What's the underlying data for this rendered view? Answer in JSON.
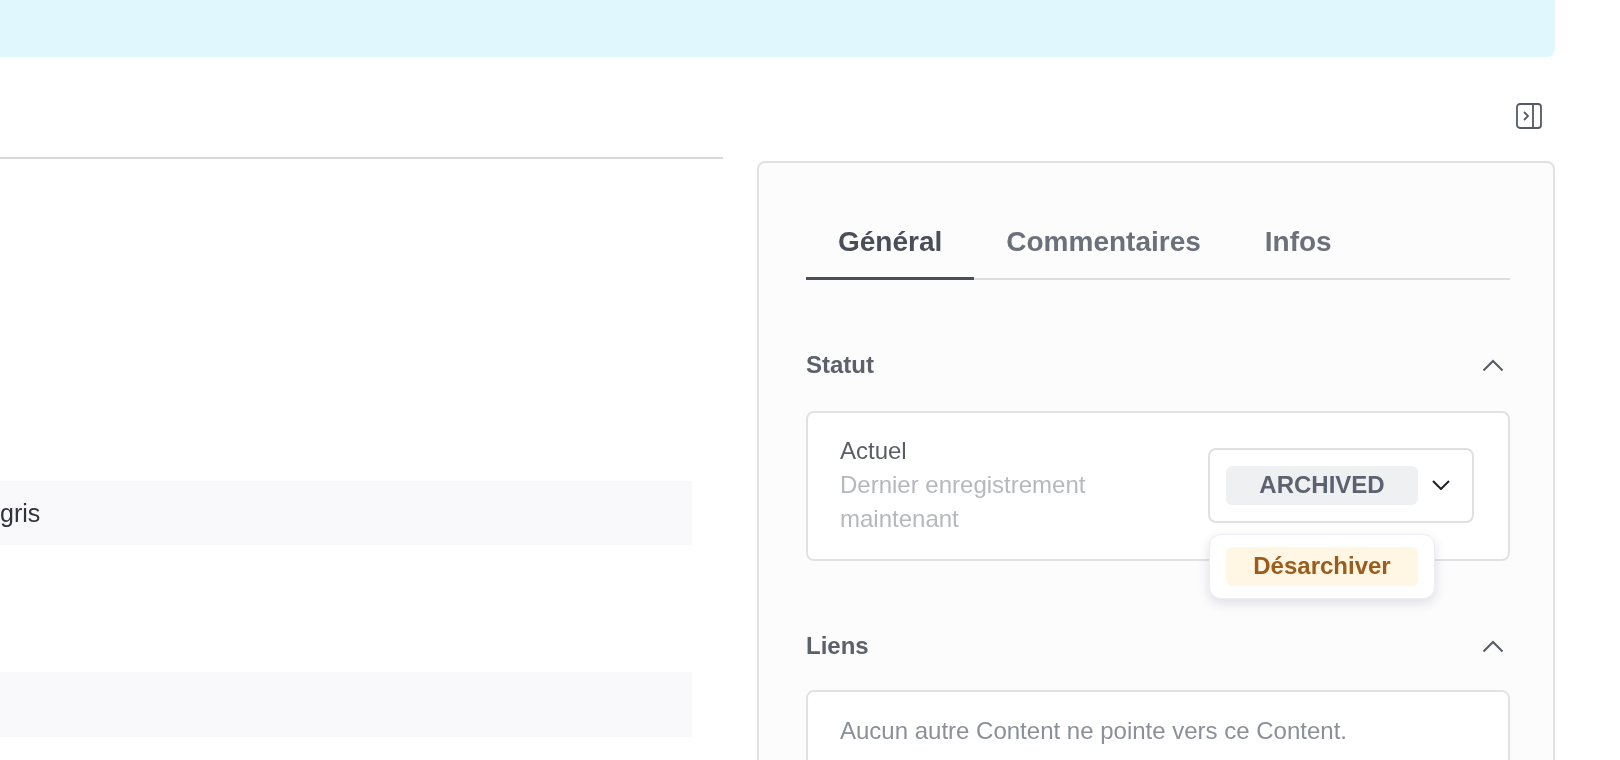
{
  "left_pane": {
    "cell_text": "gris"
  },
  "tabs": [
    {
      "label": "Général",
      "selected": true
    },
    {
      "label": "Commentaires",
      "selected": false
    },
    {
      "label": "Infos",
      "selected": false
    }
  ],
  "sections": [
    {
      "kind": "status",
      "title": "Statut",
      "expanded": true,
      "label": "Actuel",
      "hint": "Dernier enregistrement maintenant",
      "status": {
        "value": "ARCHIVED",
        "open": true,
        "options": [
          {
            "label": "Désarchiver"
          }
        ]
      }
    },
    {
      "kind": "links",
      "title": "Liens",
      "expanded": true,
      "message": "Aucun autre Content ne pointe vers ce Content."
    }
  ]
}
